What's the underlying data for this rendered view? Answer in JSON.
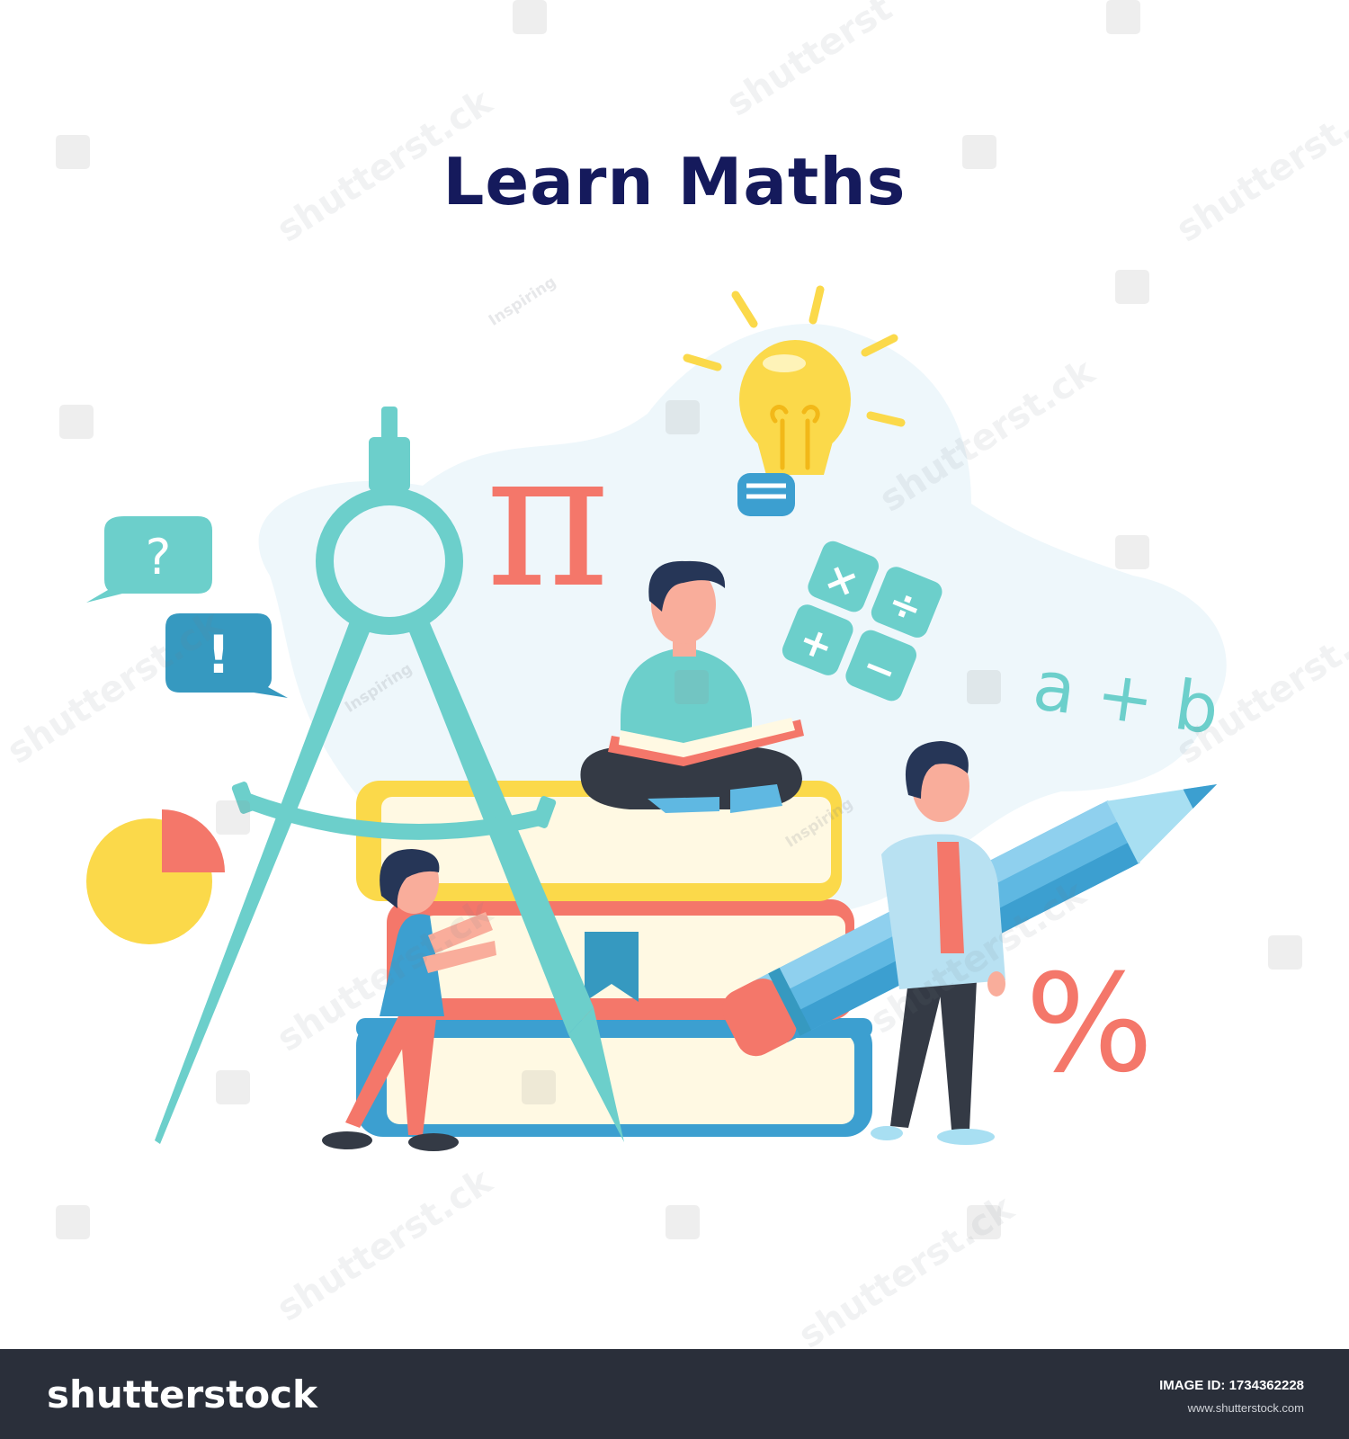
{
  "title": "Learn Maths",
  "symbols": {
    "question": "?",
    "exclamation": "!",
    "pi": "π",
    "formula": "a + b",
    "percent": "%",
    "multiply": "×",
    "divide": "÷",
    "plus": "+",
    "minus": "−"
  },
  "watermark": {
    "brand": "shutterstock",
    "credit": "Inspiring"
  },
  "footer": {
    "logo": "shutterstock",
    "image_id": "IMAGE ID: 1734362228",
    "url": "www.shutterstock.com"
  },
  "colors": {
    "title": "#151a5c",
    "blob": "#eef7fb",
    "teal": "#6ccfcb",
    "dark_blue": "#3699c0",
    "coral": "#f4776a",
    "yellow": "#fbd94a",
    "book_cream": "#fff9e3",
    "book_blue": "#3c9fd0",
    "pencil": "#5fb8e2",
    "skin": "#f9ad9b",
    "hair": "#263657",
    "footer_bg": "#2a2f3a"
  }
}
